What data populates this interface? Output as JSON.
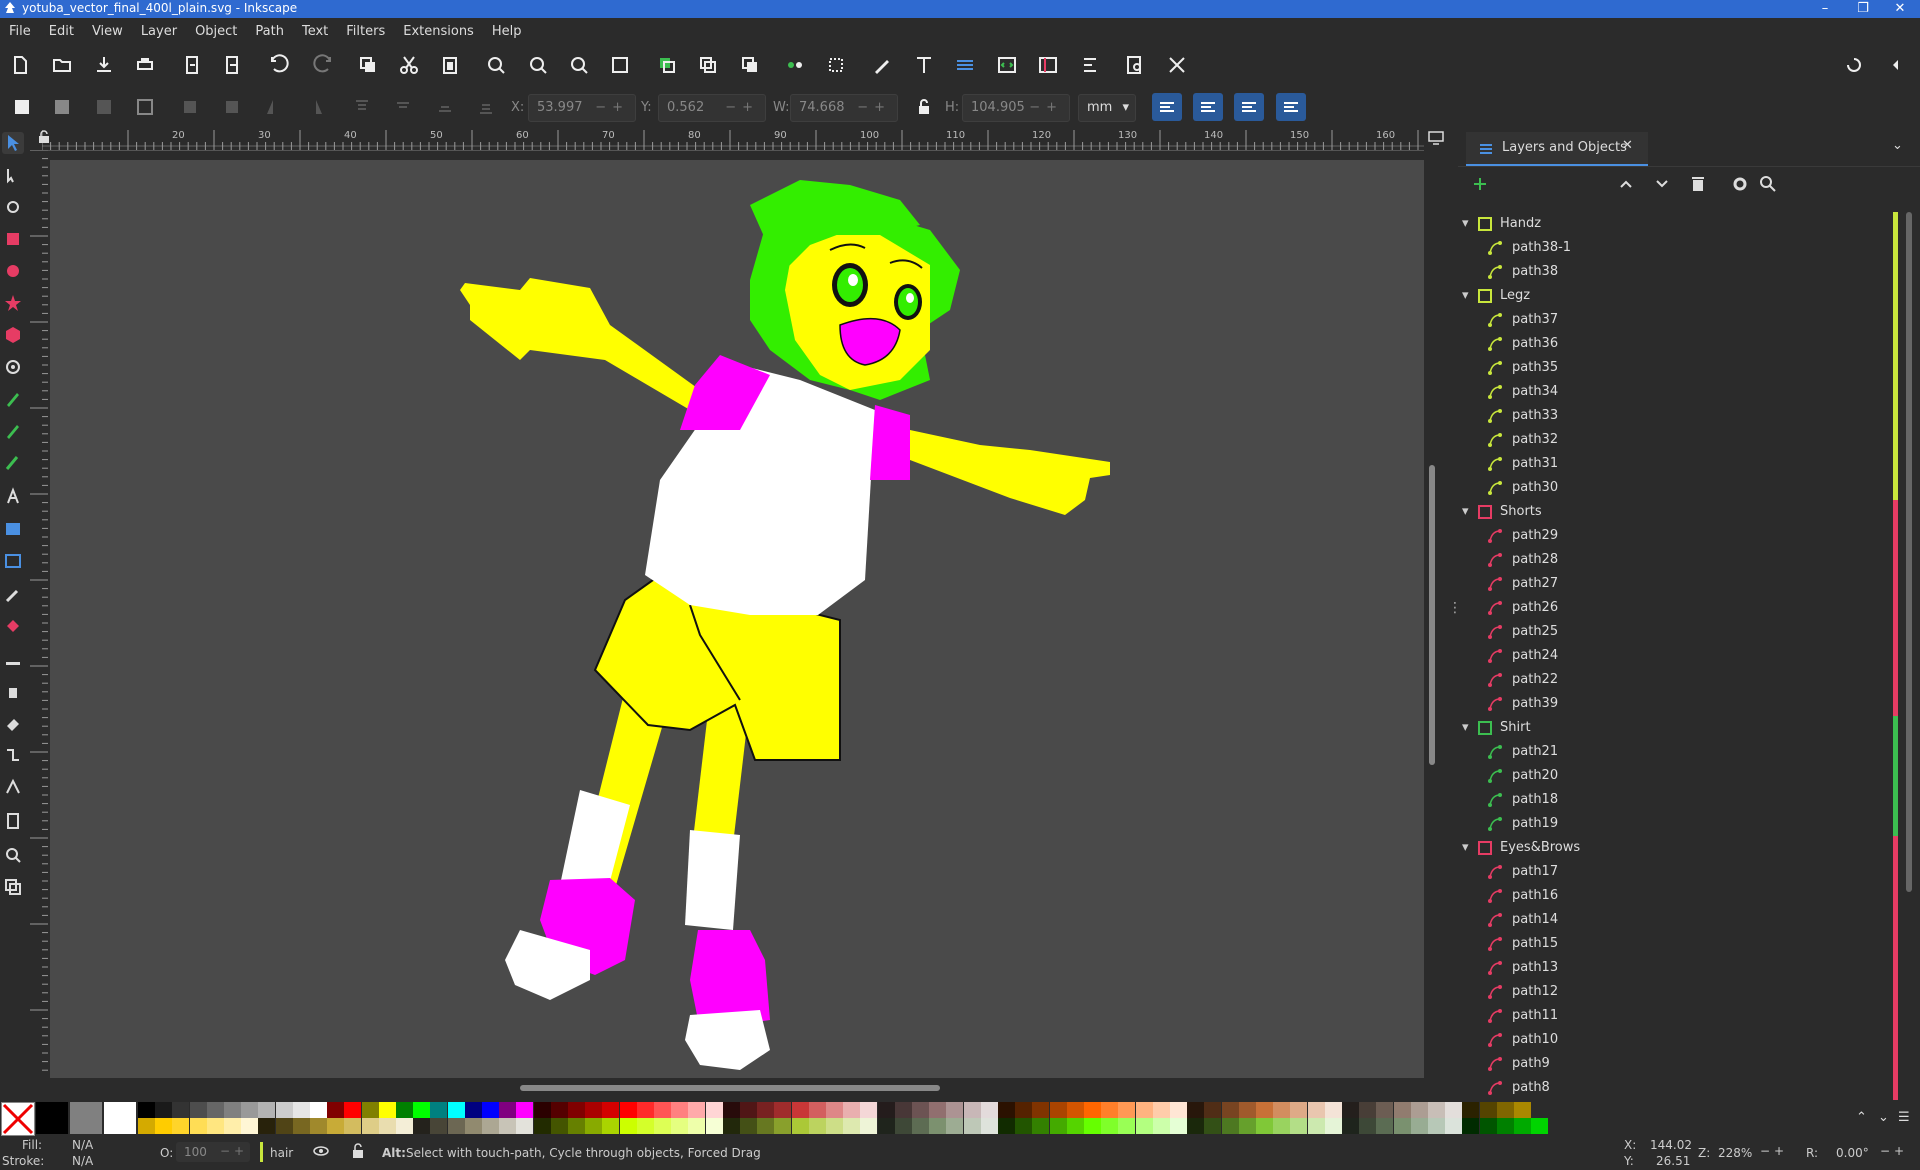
{
  "window": {
    "title": "yotuba_vector_final_400l_plain.svg - Inkscape",
    "buttons": [
      "–",
      "❐",
      "✕"
    ]
  },
  "menu": [
    "File",
    "Edit",
    "View",
    "Layer",
    "Object",
    "Path",
    "Text",
    "Filters",
    "Extensions",
    "Help"
  ],
  "controls": {
    "x": {
      "label": "X:",
      "value": "53.997"
    },
    "y": {
      "label": "Y:",
      "value": "0.562"
    },
    "w": {
      "label": "W:",
      "value": "74.668"
    },
    "h": {
      "label": "H:",
      "value": "104.905"
    },
    "unit": "mm"
  },
  "ruler": {
    "ticks": [
      "20",
      "30",
      "40",
      "50",
      "60",
      "70",
      "80",
      "90",
      "100",
      "110",
      "120",
      "130",
      "140",
      "150",
      "160"
    ],
    "vticks": [
      "10",
      "20",
      "30",
      "40",
      "50",
      "60",
      "70",
      "80",
      "90",
      "100"
    ]
  },
  "panel": {
    "tab_label": "Layers and Objects",
    "layers": [
      {
        "name": "Handz",
        "type": "layer",
        "color": "#c8e63c",
        "children": [
          "path38-1",
          "path38"
        ]
      },
      {
        "name": "Legz",
        "type": "layer",
        "color": "#c8e63c",
        "children": [
          "path37",
          "path36",
          "path35",
          "path34",
          "path33",
          "path32",
          "path31",
          "path30"
        ]
      },
      {
        "name": "Shorts",
        "type": "layer",
        "color": "#e63c64",
        "children": [
          "path29",
          "path28",
          "path27",
          "path26",
          "path25",
          "path24",
          "path22",
          "path39"
        ]
      },
      {
        "name": "Shirt",
        "type": "layer",
        "color": "#3cbe50",
        "children": [
          "path21",
          "path20",
          "path18",
          "path19"
        ]
      },
      {
        "name": "Eyes&Brows",
        "type": "layer",
        "color": "#e63c64",
        "children": [
          "path17",
          "path16",
          "path14",
          "path15",
          "path13",
          "path12",
          "path11",
          "path10",
          "path9",
          "path8"
        ]
      }
    ]
  },
  "status": {
    "fill_label": "Fill:",
    "fill_value": "N/A",
    "stroke_label": "Stroke:",
    "stroke_value": "N/A",
    "opacity_label": "O:",
    "opacity_value": "100",
    "stroke_width": "hair",
    "message_bold": "Alt:",
    "message": " Select with touch-path, Cycle through objects, Forced Drag",
    "cursor_x_label": "X:",
    "cursor_x": "144.02",
    "cursor_y_label": "Y:",
    "cursor_y": "26.51",
    "zoom_label": "Z:",
    "zoom": "228%",
    "rotate_label": "R:",
    "rotate": "0.00°"
  },
  "palette_top": [
    "#000000",
    "#1a1a1a",
    "#333333",
    "#4d4d4d",
    "#666666",
    "#808080",
    "#999999",
    "#b3b3b3",
    "#cccccc",
    "#e6e6e6",
    "#ffffff",
    "#800000",
    "#ff0000",
    "#808000",
    "#ffff00",
    "#008000",
    "#00ff00",
    "#008080",
    "#00ffff",
    "#000080",
    "#0000ff",
    "#800080",
    "#ff00ff",
    "#2b0000",
    "#550000",
    "#800000",
    "#aa0000",
    "#d40000",
    "#ff0000",
    "#ff2a2a",
    "#ff5555",
    "#ff8080",
    "#ffaaaa",
    "#ffd5d5",
    "#280b0b",
    "#501616",
    "#782121",
    "#a02c2c",
    "#c83737",
    "#d35f5f",
    "#de8787",
    "#e9afaf",
    "#f4d7d7",
    "#241c1c",
    "#483737",
    "#6c5353",
    "#916f6f",
    "#ac9393",
    "#c8b7b7",
    "#e3dbdb",
    "#2b1100",
    "#552200",
    "#803300",
    "#aa4400",
    "#d45500",
    "#ff6600",
    "#ff7f2a",
    "#ff9955",
    "#ffb380",
    "#ffccaa",
    "#ffe6d5",
    "#28170b",
    "#502d16",
    "#784421",
    "#a05a2c",
    "#c87137",
    "#d38d5f",
    "#deaa87",
    "#e9c6af",
    "#f4e3d7",
    "#241f1c",
    "#483e37",
    "#6c5d53",
    "#917c6f",
    "#ac9d93",
    "#c8beb7",
    "#e3dedb",
    "#2b2200",
    "#554400",
    "#806600",
    "#aa8800"
  ],
  "palette_bottom": [
    "#d4aa00",
    "#ffcc00",
    "#ffd42a",
    "#ffdd55",
    "#ffe680",
    "#ffeeaa",
    "#fff6d5",
    "#28220b",
    "#504416",
    "#786721",
    "#a0892c",
    "#c8ab37",
    "#d3bc5f",
    "#decd87",
    "#e9ddaf",
    "#f4eed7",
    "#24221c",
    "#484537",
    "#6c6753",
    "#918a6f",
    "#aca793",
    "#c8c4b7",
    "#e3e2db",
    "#222b00",
    "#445500",
    "#668000",
    "#88aa00",
    "#aad400",
    "#ccff00",
    "#d4ff2a",
    "#ddff55",
    "#e5ff80",
    "#eeffaa",
    "#f6ffd5",
    "#22280b",
    "#445016",
    "#677821",
    "#89a02c",
    "#abc837",
    "#bcd35f",
    "#cdde87",
    "#dde9af",
    "#eef4d7",
    "#1f241c",
    "#3e4837",
    "#5d6c53",
    "#7c916f",
    "#9dac93",
    "#bec8b7",
    "#dee3db",
    "#112b00",
    "#225500",
    "#338000",
    "#44aa00",
    "#55d400",
    "#66ff00",
    "#7fff2a",
    "#99ff55",
    "#b3ff80",
    "#ccffaa",
    "#e5ffd5",
    "#1a280b",
    "#335016",
    "#4d7821",
    "#66a02c",
    "#80c837",
    "#99d35f",
    "#b3de87",
    "#cce9af",
    "#e5f4d7",
    "#1e241c",
    "#3d4837",
    "#5b6c53",
    "#7a916f",
    "#98ac93",
    "#b7c8b7",
    "#dbe3db",
    "#002b00",
    "#005500",
    "#008000",
    "#00aa00",
    "#00d400"
  ]
}
